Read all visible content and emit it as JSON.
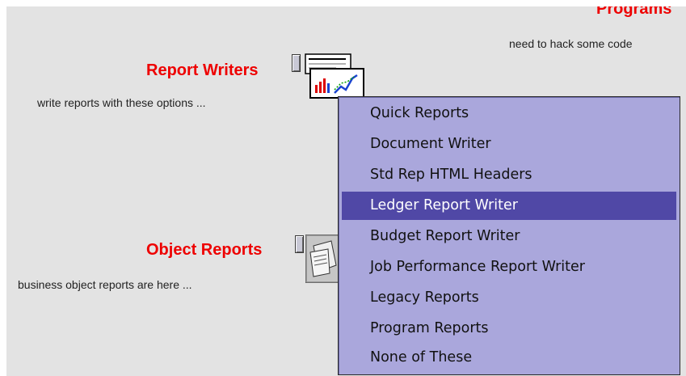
{
  "header": {
    "programs_title_partial": "Programs",
    "programs_desc": "need to hack some code"
  },
  "report_writers": {
    "title": "Report Writers",
    "desc": "write reports with these options ..."
  },
  "object_reports": {
    "title": "Object Reports",
    "desc": "business object reports are here ..."
  },
  "menu": {
    "items": [
      {
        "label": "Quick Reports",
        "selected": false
      },
      {
        "label": "Document Writer",
        "selected": false
      },
      {
        "label": "Std Rep HTML Headers",
        "selected": false
      },
      {
        "label": "Ledger Report Writer",
        "selected": true
      },
      {
        "label": "Budget Report Writer",
        "selected": false
      },
      {
        "label": "Job Performance Report Writer",
        "selected": false
      },
      {
        "label": "Legacy Reports",
        "selected": false
      },
      {
        "label": "Program Reports",
        "selected": false
      },
      {
        "label": "None of These",
        "selected": false
      }
    ]
  },
  "colors": {
    "title_red": "#ee0000",
    "menu_bg": "#aaa7dc",
    "menu_selected": "#5048a6",
    "panel_bg": "#e3e3e3"
  }
}
